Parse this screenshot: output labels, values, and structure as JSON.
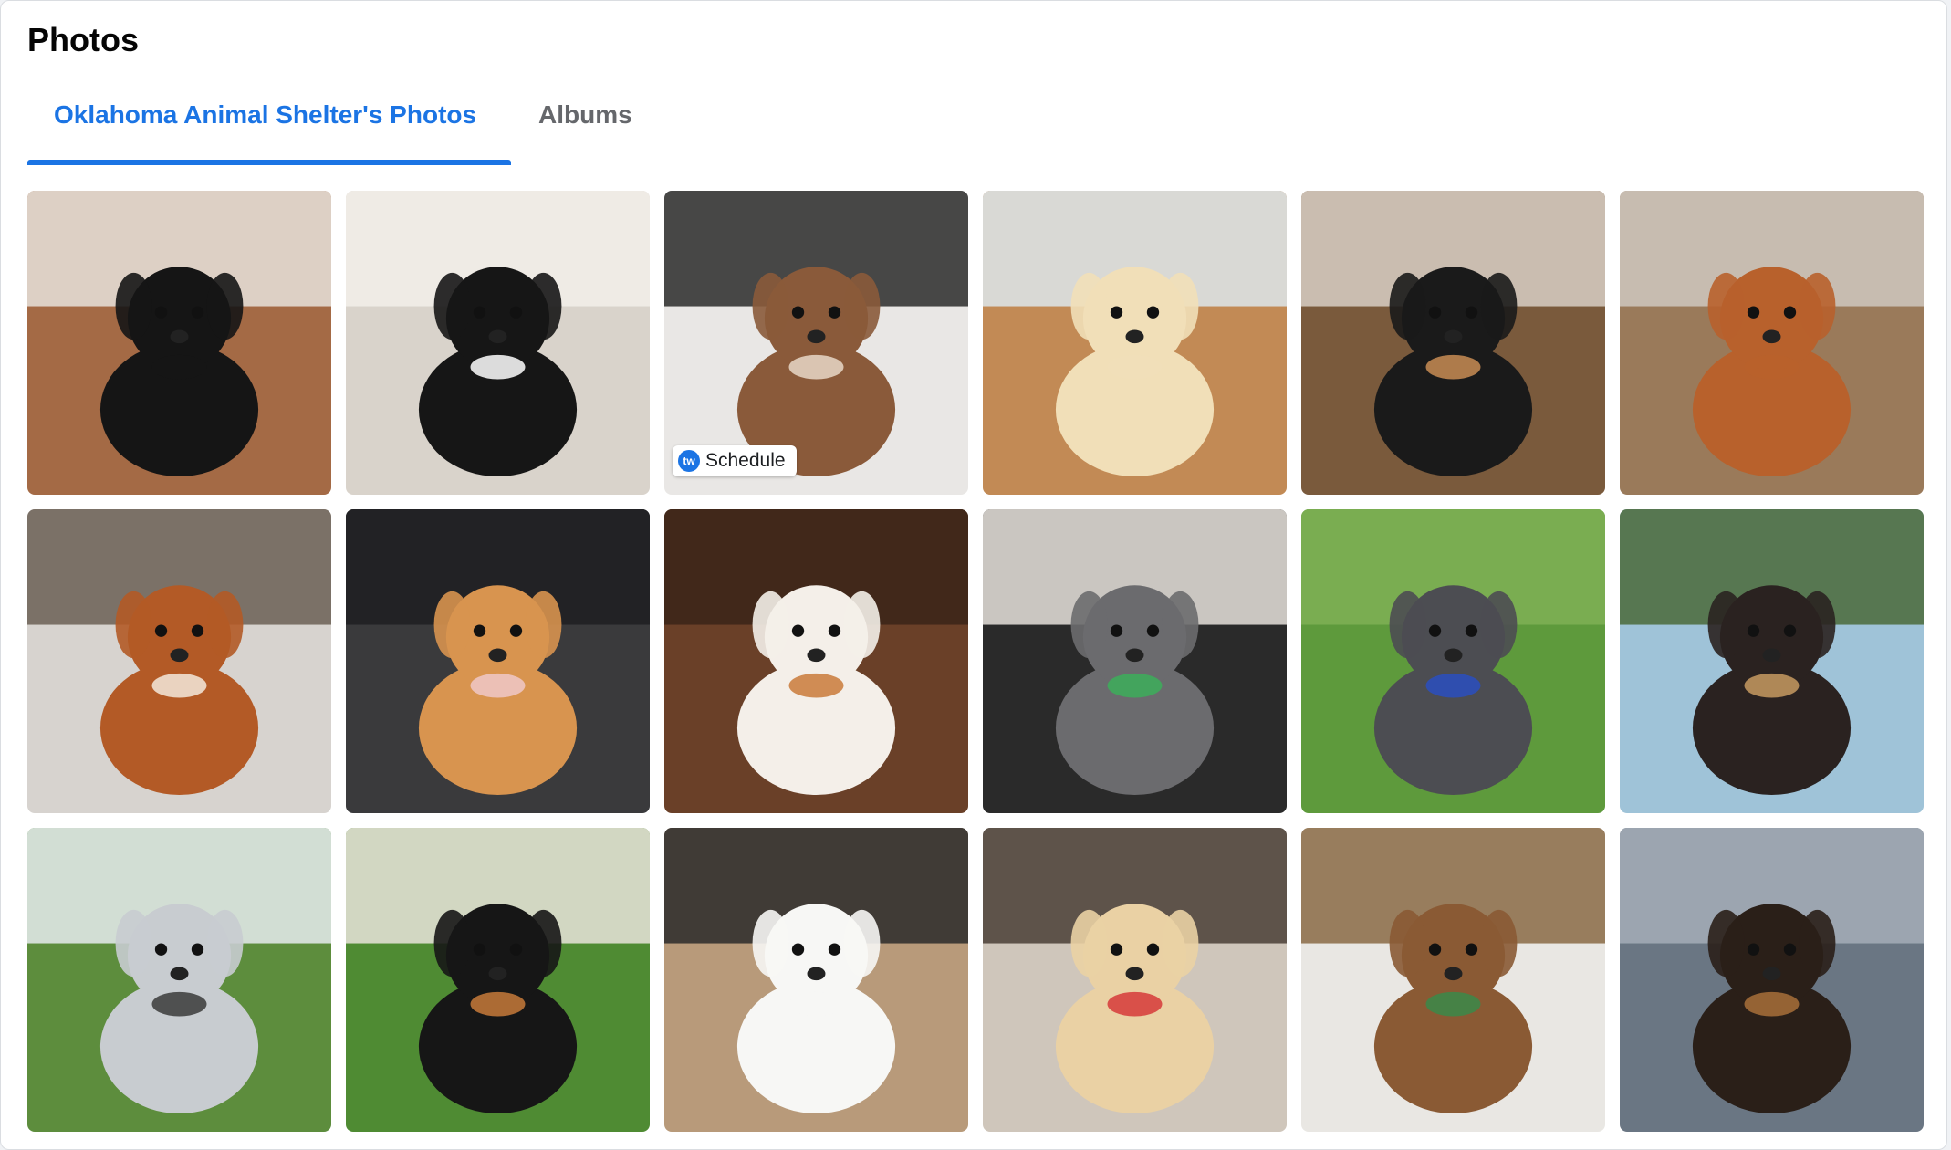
{
  "header": {
    "title": "Photos"
  },
  "tabs": [
    {
      "label": "Oklahoma Animal Shelter's Photos",
      "active": true
    },
    {
      "label": "Albums",
      "active": false
    }
  ],
  "schedule": {
    "label": "Schedule",
    "logo_text": "tw"
  },
  "colors": {
    "accent": "#1b74e4",
    "text": "#050505",
    "muted": "#65676b"
  },
  "photos": [
    {
      "name": "black-poodle-on-wood-floor",
      "bg": "#a46a45",
      "bg2": "#e8e2dc",
      "dog": "#151515",
      "accent": "#151515"
    },
    {
      "name": "black-puppy-with-white-bib",
      "bg": "#d9d3cb",
      "bg2": "#f2efea",
      "dog": "#161616",
      "accent": "#ffffff"
    },
    {
      "name": "dapple-dachshund",
      "bg": "#e9e7e5",
      "bg2": "#2a2a2a",
      "dog": "#8a5a3a",
      "accent": "#e8d8c8"
    },
    {
      "name": "yellow-lab-puppy",
      "bg": "#c28a55",
      "bg2": "#dde6ec",
      "dog": "#f1dfb8",
      "accent": "#f1dfb8"
    },
    {
      "name": "aussie-puppy-in-crate",
      "bg": "#7a5a3c",
      "bg2": "#d8cfc4",
      "dog": "#1a1a1a",
      "accent": "#c98d55"
    },
    {
      "name": "red-cavapoo-on-deck",
      "bg": "#9a7a5a",
      "bg2": "#cfc8bf",
      "dog": "#b8612c",
      "accent": "#b8612c"
    },
    {
      "name": "red-cavapoo-on-couch",
      "bg": "#d7d3cf",
      "bg2": "#6b5f55",
      "dog": "#b35a26",
      "accent": "#f3e9dc"
    },
    {
      "name": "corgi-in-car",
      "bg": "#3a3a3c",
      "bg2": "#1f1f21",
      "dog": "#d8944f",
      "accent": "#f0c8c8"
    },
    {
      "name": "cavalier-puppy",
      "bg": "#6a4028",
      "bg2": "#3a2418",
      "dog": "#f4efe9",
      "accent": "#c97a3a"
    },
    {
      "name": "grey-french-bulldog-with-toy",
      "bg": "#2a2a2a",
      "bg2": "#e6e2dc",
      "dog": "#6b6b6e",
      "accent": "#3cae5a"
    },
    {
      "name": "french-bulldog-on-grass",
      "bg": "#5e9a3c",
      "bg2": "#7fb055",
      "dog": "#4c4d52",
      "accent": "#2a4fbf"
    },
    {
      "name": "chihuahua-on-blanket",
      "bg": "#9fc3d8",
      "bg2": "#4a6a3a",
      "dog": "#2a2220",
      "accent": "#c79a62"
    },
    {
      "name": "merle-puppy-on-lawn",
      "bg": "#5d8d3d",
      "bg2": "#e6ecef",
      "dog": "#c8ccd0",
      "accent": "#3a3a3a"
    },
    {
      "name": "tricolor-corgi-on-grass",
      "bg": "#4f8b33",
      "bg2": "#e9e4dc",
      "dog": "#161616",
      "accent": "#c77a3a"
    },
    {
      "name": "white-maltese-in-crate",
      "bg": "#b89a7a",
      "bg2": "#2a2a2a",
      "dog": "#f7f7f5",
      "accent": "#f7f7f5"
    },
    {
      "name": "golden-retriever-puppy",
      "bg": "#cfc6bb",
      "bg2": "#4a3e36",
      "dog": "#ead1a4",
      "accent": "#d63a3a"
    },
    {
      "name": "cavapoo-on-open-farm-box",
      "bg": "#e9e7e3",
      "bg2": "#8a6a45",
      "dog": "#8a5a34",
      "accent": "#3a8a4a"
    },
    {
      "name": "yorkie-puppies-on-sofa",
      "bg": "#6a7683",
      "bg2": "#a4aeb8",
      "dog": "#2a1f18",
      "accent": "#a8703a"
    }
  ]
}
